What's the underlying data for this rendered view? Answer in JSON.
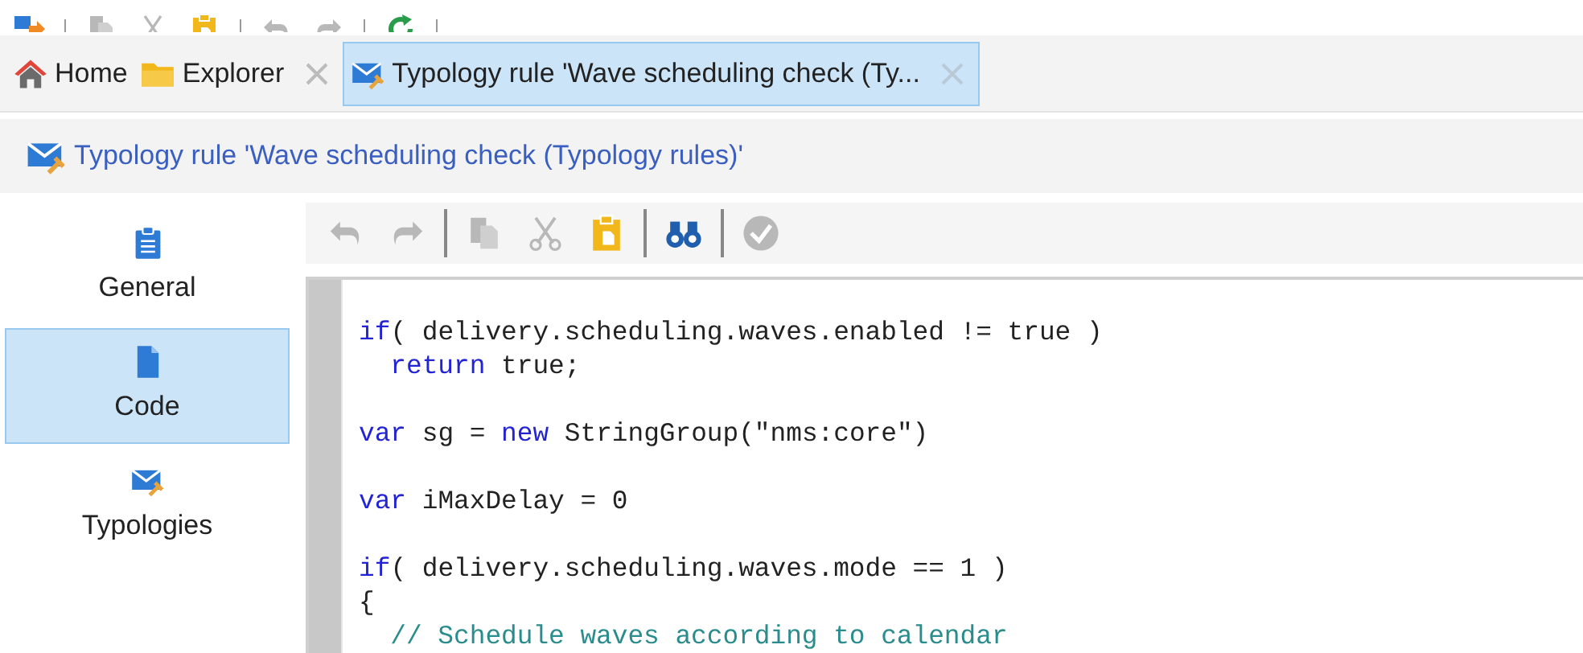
{
  "top_toolbar": [
    {
      "kind": "import",
      "disabled": false
    },
    {
      "kind": "copy",
      "disabled": true
    },
    {
      "kind": "cut",
      "disabled": true
    },
    {
      "kind": "paste",
      "disabled": false
    },
    {
      "kind": "undo",
      "disabled": true
    },
    {
      "kind": "redo",
      "disabled": true
    },
    {
      "kind": "refresh",
      "disabled": false
    }
  ],
  "tabs": [
    {
      "kind": "home",
      "label": "Home",
      "selected": false,
      "closable": false
    },
    {
      "kind": "folder",
      "label": "Explorer",
      "selected": false,
      "closable": true
    },
    {
      "kind": "rule",
      "label": "Typology rule 'Wave scheduling check (Ty...",
      "selected": true,
      "closable": true
    }
  ],
  "breadcrumb": {
    "label": "Typology rule 'Wave scheduling check (Typology rules)'"
  },
  "sidebar": {
    "items": [
      {
        "kind": "general",
        "label": "General",
        "selected": false
      },
      {
        "kind": "code",
        "label": "Code",
        "selected": true
      },
      {
        "kind": "typologies",
        "label": "Typologies",
        "selected": false
      }
    ]
  },
  "editor_toolbar": [
    {
      "kind": "undo",
      "disabled": true
    },
    {
      "kind": "redo",
      "disabled": true
    },
    {
      "kind": "sep"
    },
    {
      "kind": "copy",
      "disabled": true
    },
    {
      "kind": "cut",
      "disabled": true
    },
    {
      "kind": "paste",
      "disabled": false
    },
    {
      "kind": "sep"
    },
    {
      "kind": "find",
      "disabled": false
    },
    {
      "kind": "sep"
    },
    {
      "kind": "check",
      "disabled": true
    }
  ],
  "code_lines": [
    {
      "kind": "code",
      "indent": false,
      "tokens": [
        {
          "kind": "keyword",
          "text": "if"
        },
        {
          "kind": "plain",
          "text": "( delivery.scheduling.waves.enabled != true )"
        }
      ]
    },
    {
      "kind": "code",
      "indent": true,
      "tokens": [
        {
          "kind": "keyword",
          "text": "return"
        },
        {
          "kind": "plain",
          "text": " true;"
        }
      ]
    },
    {
      "kind": "blank"
    },
    {
      "kind": "code",
      "indent": false,
      "tokens": [
        {
          "kind": "keyword",
          "text": "var"
        },
        {
          "kind": "plain",
          "text": " sg = "
        },
        {
          "kind": "keyword",
          "text": "new"
        },
        {
          "kind": "plain",
          "text": " StringGroup(\"nms:core\")"
        }
      ]
    },
    {
      "kind": "blank"
    },
    {
      "kind": "code",
      "indent": false,
      "tokens": [
        {
          "kind": "keyword",
          "text": "var"
        },
        {
          "kind": "plain",
          "text": " iMaxDelay = 0"
        }
      ]
    },
    {
      "kind": "blank"
    },
    {
      "kind": "code",
      "indent": false,
      "tokens": [
        {
          "kind": "keyword",
          "text": "if"
        },
        {
          "kind": "plain",
          "text": "( delivery.scheduling.waves.mode == 1 )"
        }
      ]
    },
    {
      "kind": "code",
      "indent": false,
      "tokens": [
        {
          "kind": "plain",
          "text": "{"
        }
      ]
    },
    {
      "kind": "code",
      "indent": true,
      "tokens": [
        {
          "kind": "comment",
          "text": "// Schedule waves according to calendar"
        }
      ]
    }
  ]
}
